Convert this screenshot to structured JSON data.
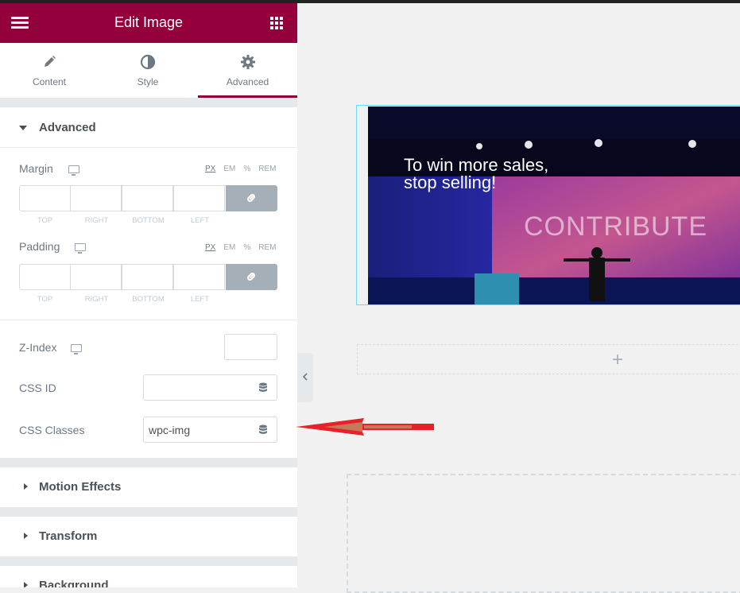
{
  "header": {
    "title": "Edit Image",
    "menu_icon": "hamburger-icon",
    "apps_icon": "grid-icon"
  },
  "tabs": [
    {
      "label": "Content",
      "icon": "pencil-icon"
    },
    {
      "label": "Style",
      "icon": "contrast-icon"
    },
    {
      "label": "Advanced",
      "icon": "gear-icon",
      "active": true
    }
  ],
  "advanced": {
    "title": "Advanced",
    "units": [
      "PX",
      "EM",
      "%",
      "REM"
    ],
    "margin": {
      "label": "Margin",
      "sides": [
        "TOP",
        "RIGHT",
        "BOTTOM",
        "LEFT"
      ],
      "values": [
        "",
        "",
        "",
        ""
      ]
    },
    "padding": {
      "label": "Padding",
      "sides": [
        "TOP",
        "RIGHT",
        "BOTTOM",
        "LEFT"
      ],
      "values": [
        "",
        "",
        "",
        ""
      ]
    },
    "z_index": {
      "label": "Z-Index",
      "value": ""
    },
    "css_id": {
      "label": "CSS ID",
      "value": ""
    },
    "css_classes": {
      "label": "CSS Classes",
      "value": "wpc-img"
    }
  },
  "sections": [
    "Motion Effects",
    "Transform",
    "Background"
  ],
  "canvas": {
    "image_text": {
      "line1": "To win more sales,",
      "line2": "stop selling!",
      "banner": "CONTRIBUTE"
    },
    "add_icon": "+"
  },
  "colors": {
    "brand": "#93003c",
    "panel_bg": "#e6e9ec",
    "canvas_bg": "#f1f1f1",
    "arrow": "#e8202a",
    "selection": "#71d7f7"
  }
}
